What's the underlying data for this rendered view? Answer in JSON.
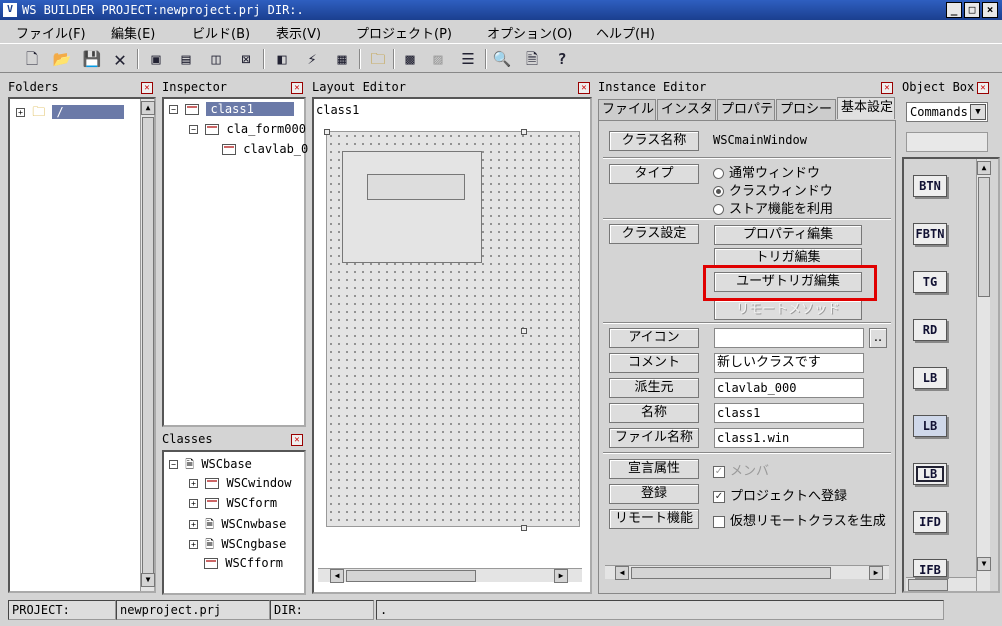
{
  "window": {
    "title": "WS BUILDER PROJECT:newproject.prj DIR:."
  },
  "menu": [
    "ファイル(F)",
    "編集(E)",
    "ビルド(B)",
    "表示(V)",
    "プロジェクト(P)",
    "オプション(O)",
    "ヘルプ(H)"
  ],
  "toolbar_icons": [
    "new-file-icon",
    "open-folder-icon",
    "save-icon",
    "cut-icon",
    "new-window-icon",
    "open-window-icon",
    "copy-window-icon",
    "delete-window-icon",
    "class-icon",
    "edit-class-icon",
    "class-list-icon",
    "folder-icon",
    "grid-icon",
    "disabled-grid-icon",
    "list-icon",
    "search-icon",
    "preview-icon",
    "help-icon"
  ],
  "folders": {
    "title": "Folders",
    "root": "/"
  },
  "inspector": {
    "title": "Inspector",
    "items": [
      "class1",
      "cla_form000",
      "clavlab_0"
    ]
  },
  "classes": {
    "title": "Classes",
    "items": [
      "WSCbase",
      "WSCwindow",
      "WSCform",
      "WSCnwbase",
      "WSCngbase",
      "WSCfform"
    ]
  },
  "layout_editor": {
    "title": "Layout Editor",
    "label": "class1"
  },
  "instance_editor": {
    "title": "Instance Editor",
    "tabs": [
      "ファイル",
      "インスタ",
      "プロパテ",
      "プロシー",
      "基本設定"
    ],
    "class_name_label": "クラス名称",
    "class_name_value": "WSCmainWindow",
    "type_label": "タイプ",
    "type_options": [
      "通常ウィンドウ",
      "クラスウィンドウ",
      "ストア機能を利用"
    ],
    "class_setting_label": "クラス設定",
    "setting_buttons": [
      "プロパティ編集",
      "トリガ編集",
      "ユーザトリガ編集",
      "リモートメソッド"
    ],
    "icon_label": "アイコン",
    "icon_value": "",
    "browse_label": "..",
    "comment_label": "コメント",
    "comment_value": "新しいクラスです",
    "derive_label": "派生元",
    "derive_value": "clavlab_000",
    "name_label": "名称",
    "name_value": "class1",
    "file_label": "ファイル名称",
    "file_value": "class1.win",
    "decl_label": "宣言属性",
    "decl_value": "メンバ",
    "register_label": "登録",
    "register_value": "プロジェクトへ登録",
    "remote_label": "リモート機能",
    "remote_value": "仮想リモートクラスを生成"
  },
  "object_box": {
    "title": "Object Box",
    "combo": "Commands",
    "items": [
      "BTN",
      "FBTN",
      "TG",
      "RD",
      "LB",
      "LB",
      "LB",
      "IFD",
      "IFB"
    ]
  },
  "status": {
    "project_label": "PROJECT:",
    "project_value": "newproject.prj",
    "dir_label": "DIR:",
    "dir_value": "."
  },
  "colors": {
    "title_bar": "#1b3f8f",
    "selection": "#6b7aa8",
    "highlight_box": "#e00000"
  }
}
